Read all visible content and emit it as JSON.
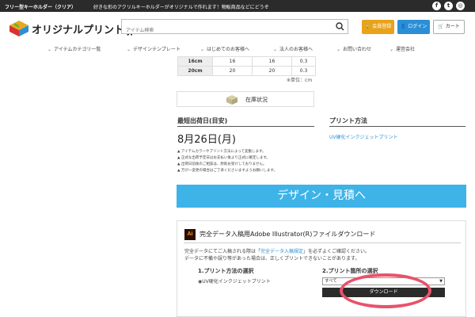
{
  "topbar": {
    "title": "フリー型キーホルダー（クリア）",
    "tagline": "好きな形のアクリルキーホルダーがオリジナルで作れます！物販商品などにどうぞ",
    "social": [
      {
        "icon": "facebook-icon",
        "glyph": "f"
      },
      {
        "icon": "twitter-icon",
        "glyph": "t"
      },
      {
        "icon": "instagram-icon",
        "glyph": "◎"
      }
    ]
  },
  "header": {
    "logo_text": "オリジナルプリント.jp",
    "search_placeholder": "アイテム検索",
    "member_label": "会員登録",
    "login_label": "ログイン",
    "cart_label": "カート",
    "colors": {
      "member": "#e9a21a",
      "login": "#2b8fd6"
    }
  },
  "nav": {
    "items": [
      "アイテムカテゴリ一覧",
      "デザインテンプレート",
      "はじめてのお客様へ",
      "法人のお客様へ",
      "お問い合わせ",
      "運営会社"
    ]
  },
  "size_table": {
    "rows": [
      [
        "16cm",
        "16",
        "16",
        "0.3"
      ],
      [
        "20cm",
        "20",
        "20",
        "0.3"
      ]
    ],
    "unit": "※単位：cm"
  },
  "stock": {
    "label": "在庫状況"
  },
  "shipping": {
    "heading": "最短出荷日(目安)",
    "date": "8月26日(月)",
    "notes": [
      "アイテムカラーやプリント方法によって変動します。",
      "正式な出荷予定日はお支払い後より正式に確定します。",
      "出荷日前後のご相談は、原則お受けしておりません。",
      "万が一変更の場合はご了承くださいますようお願いします。"
    ]
  },
  "print_method": {
    "heading": "プリント方法",
    "link": "UV硬化インクジェットプリント"
  },
  "design_button": {
    "label": "デザイン・見積へ",
    "color": "#3db3e8"
  },
  "download": {
    "icon_text": "Ai",
    "title": "完全データ入稿用Adobe Illustrator(R)ファイルダウンロード",
    "para1_pre": "完全データにてご入稿される際は「",
    "para1_link": "完全データ入稿規定",
    "para1_post": "」を必ずよくご確認ください。",
    "para2": "データに不備や誤り等があった場合は、正しくプリントできないことがあります。",
    "step1_heading": "1.プリント方法の選択",
    "step1_value": "UV硬化インクジェットプリント",
    "step2_heading": "2.プリント箇所の選択",
    "select_value": "すべて",
    "button_label": "ダウンロード",
    "highlight_color": "#e8526b"
  }
}
